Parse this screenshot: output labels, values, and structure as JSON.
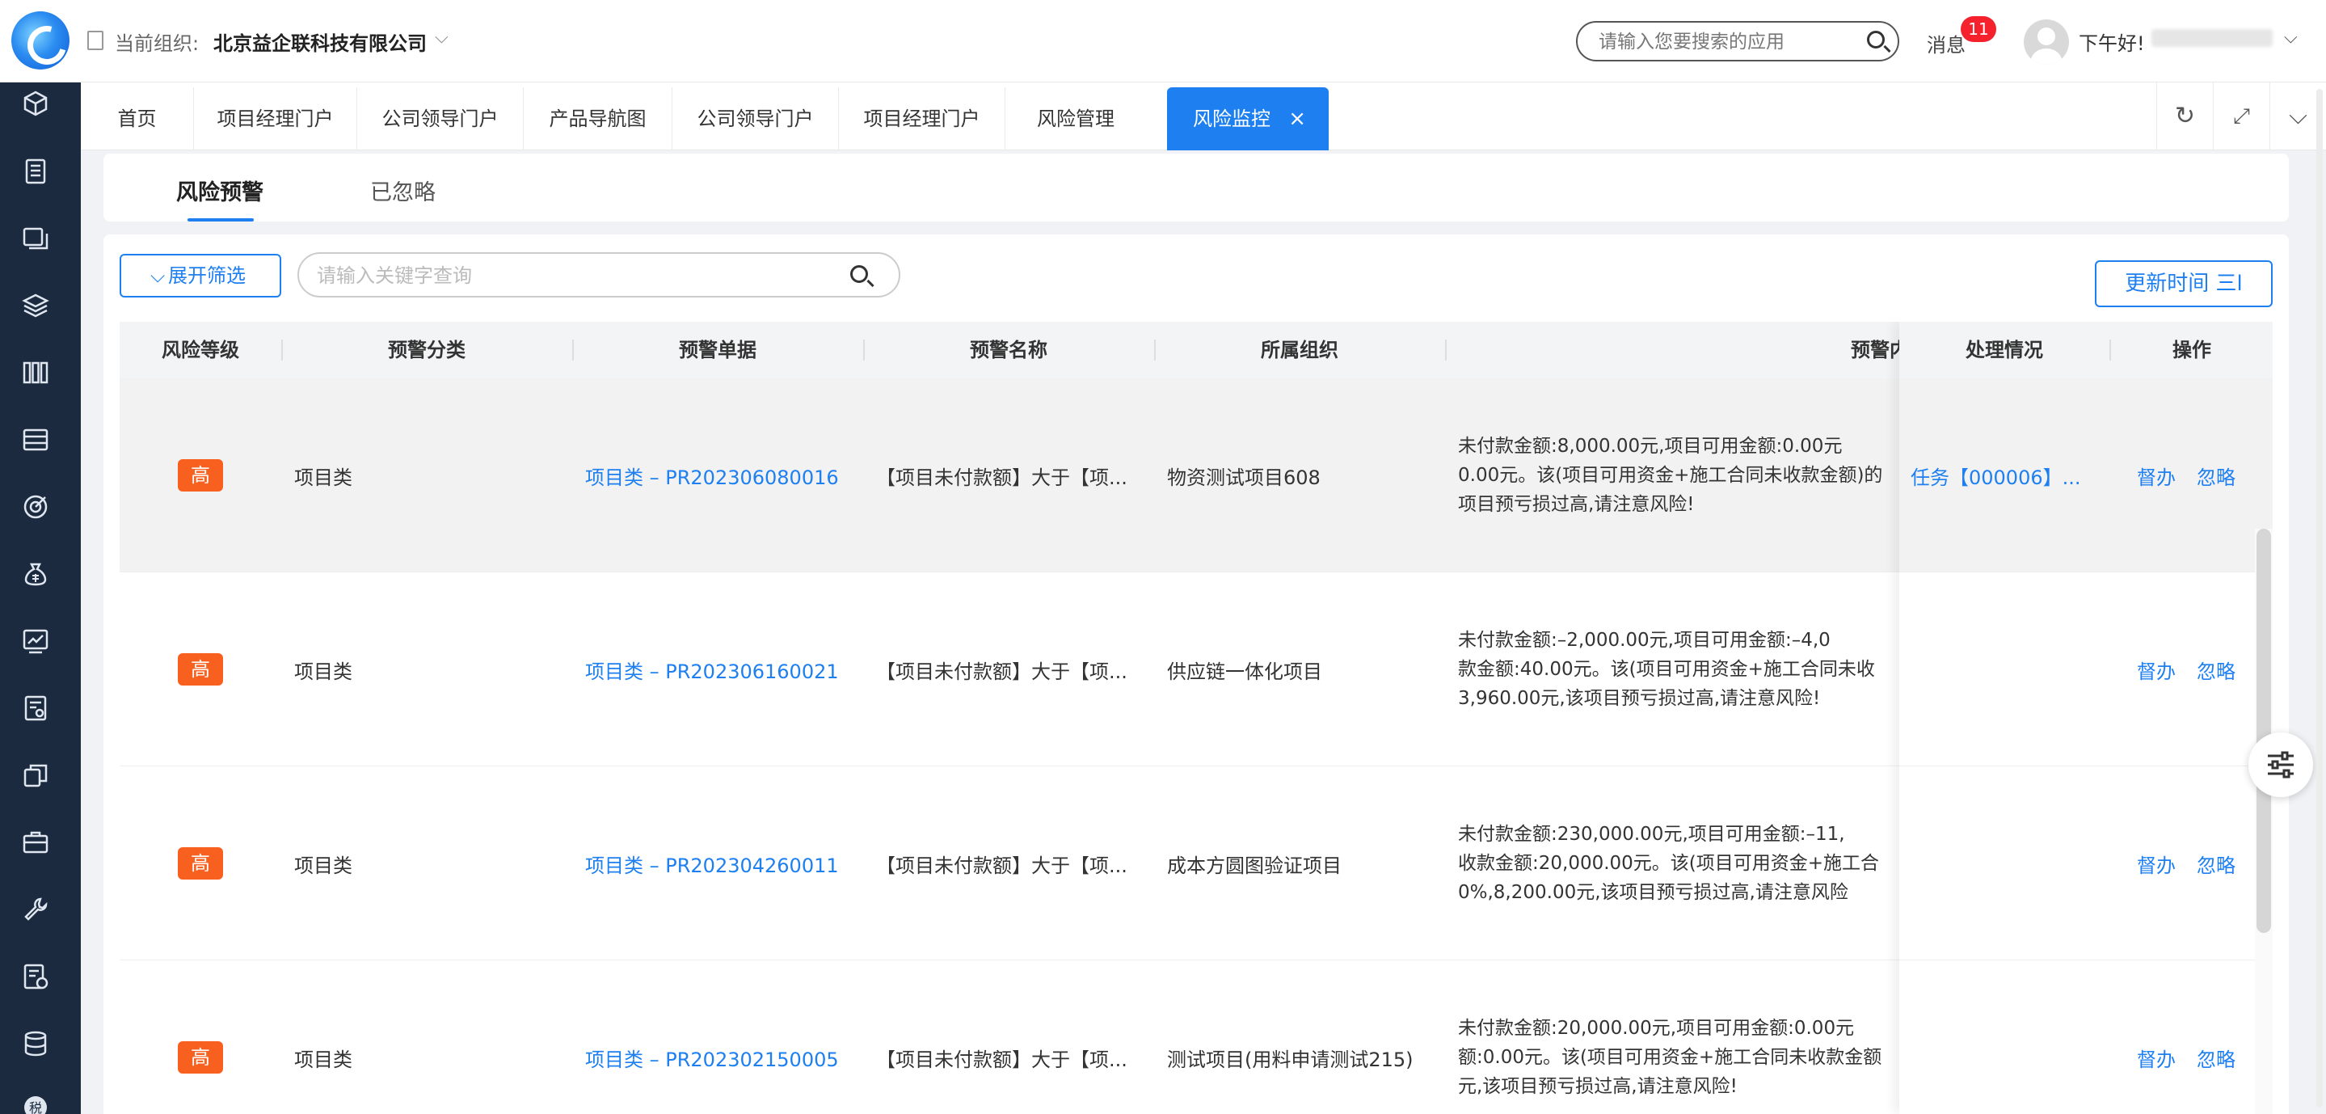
{
  "header": {
    "org_label": "当前组织:",
    "org_name": "北京益企联科技有限公司",
    "search_placeholder": "请输入您要搜索的应用",
    "messages_label": "消息",
    "messages_count": "11",
    "greeting": "下午好!"
  },
  "sidebar": {
    "icons": [
      "cube-icon",
      "ledger-icon",
      "documents-icon",
      "layers-icon",
      "columns-icon",
      "server-icon",
      "target-icon",
      "money-bag-icon",
      "chart-trend-icon",
      "report-icon",
      "copy-icon",
      "briefcase-icon",
      "wrench-icon",
      "invoice-icon",
      "database-icon",
      "tax-icon"
    ]
  },
  "tabs": [
    {
      "label": "首页"
    },
    {
      "label": "项目经理门户"
    },
    {
      "label": "公司领导门户"
    },
    {
      "label": "产品导航图"
    },
    {
      "label": "公司领导门户"
    },
    {
      "label": "项目经理门户"
    },
    {
      "label": "风险管理"
    },
    {
      "label": "风险监控",
      "active": true
    }
  ],
  "subtabs": [
    {
      "label": "风险预警",
      "active": true
    },
    {
      "label": "已忽略"
    }
  ],
  "toolbar": {
    "filter_label": "展开筛选",
    "search_placeholder": "请输入关键字查询",
    "update_label": "更新时间 三l"
  },
  "table": {
    "columns": [
      "风险等级",
      "预警分类",
      "预警单据",
      "预警名称",
      "所属组织",
      "预警内容",
      "处理情况",
      "操作"
    ],
    "rows": [
      {
        "level": "高",
        "category": "项目类",
        "document": "项目类 – PR202306080016",
        "name": "【项目未付款额】大于【项...",
        "org": "物资测试项目608",
        "content": "未付款金额:8,000.00元,项目可用金额:0.00元\n0.00元。该(项目可用资金+施工合同未收款金额)的\n项目预亏损过高,请注意风险!",
        "status": "任务【000006】...",
        "op_supervise": "督办",
        "op_ignore": "忽略"
      },
      {
        "level": "高",
        "category": "项目类",
        "document": "项目类 – PR202306160021",
        "name": "【项目未付款额】大于【项...",
        "org": "供应链一体化项目",
        "content": "未付款金额:–2,000.00元,项目可用金额:–4,0\n款金额:40.00元。该(项目可用资金+施工合同未收\n3,960.00元,该项目预亏损过高,请注意风险!",
        "status": "",
        "op_supervise": "督办",
        "op_ignore": "忽略"
      },
      {
        "level": "高",
        "category": "项目类",
        "document": "项目类 – PR202304260011",
        "name": "【项目未付款额】大于【项...",
        "org": "成本方圆图验证项目",
        "content": "未付款金额:230,000.00元,项目可用金额:–11,\n收款金额:20,000.00元。该(项目可用资金+施工合\n0%,8,200.00元,该项目预亏损过高,请注意风险",
        "status": "",
        "op_supervise": "督办",
        "op_ignore": "忽略"
      },
      {
        "level": "高",
        "category": "项目类",
        "document": "项目类 – PR202302150005",
        "name": "【项目未付款额】大于【项...",
        "org": "测试项目(用料申请测试215)",
        "content": "未付款金额:20,000.00元,项目可用金额:0.00元\n额:0.00元。该(项目可用资金+施工合同未收款金额\n元,该项目预亏损过高,请注意风险!",
        "status": "",
        "op_supervise": "督办",
        "op_ignore": "忽略"
      }
    ]
  }
}
